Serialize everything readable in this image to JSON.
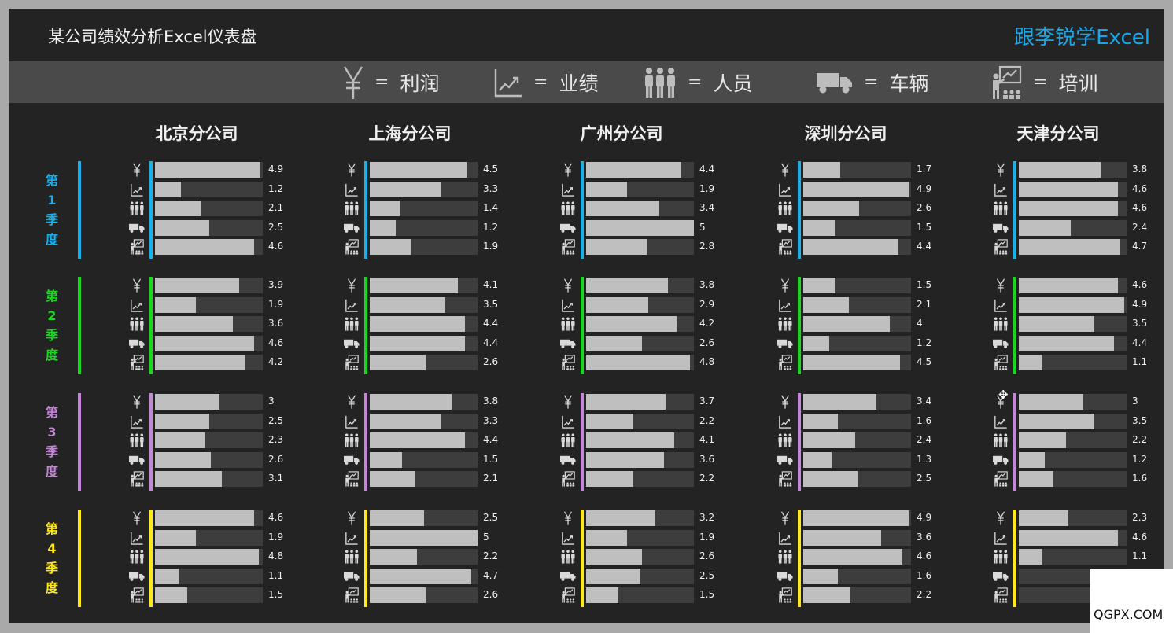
{
  "title": "某公司绩效分析Excel仪表盘",
  "brand": "跟李锐学Excel",
  "legend": [
    {
      "icon": "yen-icon",
      "eq": "=",
      "label": "利润"
    },
    {
      "icon": "line-chart-icon",
      "eq": "=",
      "label": "业绩"
    },
    {
      "icon": "people-icon",
      "eq": "=",
      "label": "人员"
    },
    {
      "icon": "truck-icon",
      "eq": "=",
      "label": "车辆"
    },
    {
      "icon": "training-icon",
      "eq": "=",
      "label": "培训"
    }
  ],
  "branches": [
    "北京分公司",
    "上海分公司",
    "广州分公司",
    "深圳分公司",
    "天津分公司"
  ],
  "quarters": [
    {
      "chars": [
        "第",
        "1",
        "季",
        "度"
      ],
      "color": "#1ab0ea"
    },
    {
      "chars": [
        "第",
        "2",
        "季",
        "度"
      ],
      "color": "#19d61e"
    },
    {
      "chars": [
        "第",
        "3",
        "季",
        "度"
      ],
      "color": "#c486d6"
    },
    {
      "chars": [
        "第",
        "4",
        "季",
        "度"
      ],
      "color": "#ffe81a"
    }
  ],
  "max_value": 5,
  "values": [
    [
      [
        "4.9",
        "1.2",
        "2.1",
        "2.5",
        "4.6"
      ],
      [
        "4.5",
        "3.3",
        "1.4",
        "1.2",
        "1.9"
      ],
      [
        "4.4",
        "1.9",
        "3.4",
        "5",
        "2.8"
      ],
      [
        "1.7",
        "4.9",
        "2.6",
        "1.5",
        "4.4"
      ],
      [
        "3.8",
        "4.6",
        "4.6",
        "2.4",
        "4.7"
      ]
    ],
    [
      [
        "3.9",
        "1.9",
        "3.6",
        "4.6",
        "4.2"
      ],
      [
        "4.1",
        "3.5",
        "4.4",
        "4.4",
        "2.6"
      ],
      [
        "3.8",
        "2.9",
        "4.2",
        "2.6",
        "4.8"
      ],
      [
        "1.5",
        "2.1",
        "4",
        "1.2",
        "4.5"
      ],
      [
        "4.6",
        "4.9",
        "3.5",
        "4.4",
        "1.1"
      ]
    ],
    [
      [
        "3",
        "2.5",
        "2.3",
        "2.6",
        "3.1"
      ],
      [
        "3.8",
        "3.3",
        "4.4",
        "1.5",
        "2.1"
      ],
      [
        "3.7",
        "2.2",
        "4.1",
        "3.6",
        "2.2"
      ],
      [
        "3.4",
        "1.6",
        "2.4",
        "1.3",
        "2.5"
      ],
      [
        "3",
        "3.5",
        "2.2",
        "1.2",
        "1.6"
      ]
    ],
    [
      [
        "4.6",
        "1.9",
        "4.8",
        "1.1",
        "1.5"
      ],
      [
        "2.5",
        "5",
        "2.2",
        "4.7",
        "2.6"
      ],
      [
        "3.2",
        "1.9",
        "2.6",
        "2.5",
        "1.5"
      ],
      [
        "4.9",
        "3.6",
        "4.6",
        "1.6",
        "2.2"
      ],
      [
        "2.3",
        "4.6",
        "1.1",
        "",
        ""
      ]
    ]
  ],
  "colors": {
    "background": "#232323",
    "frame": "#a9a9a9",
    "legend_band": "#4a4a4a",
    "bar_fill": "#bfbfbf",
    "bar_track": "#3d3d3d",
    "brand": "#19a7e9"
  },
  "watermark": "QGPX.COM"
}
